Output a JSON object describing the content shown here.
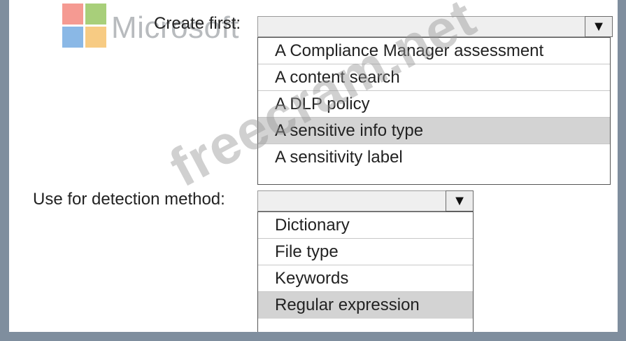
{
  "logo": {
    "text": "Microsoft"
  },
  "watermark": "freecram.net",
  "question1": {
    "label": "Create first:",
    "options": [
      "A Compliance Manager assessment",
      "A content search",
      "A DLP policy",
      "A sensitive info type",
      "A sensitivity label"
    ],
    "selected": "A sensitive info type"
  },
  "question2": {
    "label": "Use for detection method:",
    "options": [
      "Dictionary",
      "File type",
      "Keywords",
      "Regular expression"
    ],
    "selected": "Regular expression"
  },
  "icons": {
    "dropdown_arrow": "triangle-down-icon"
  },
  "colors": {
    "page_bg": "#7f8e9e",
    "selected_bg": "#d3d3d3"
  }
}
